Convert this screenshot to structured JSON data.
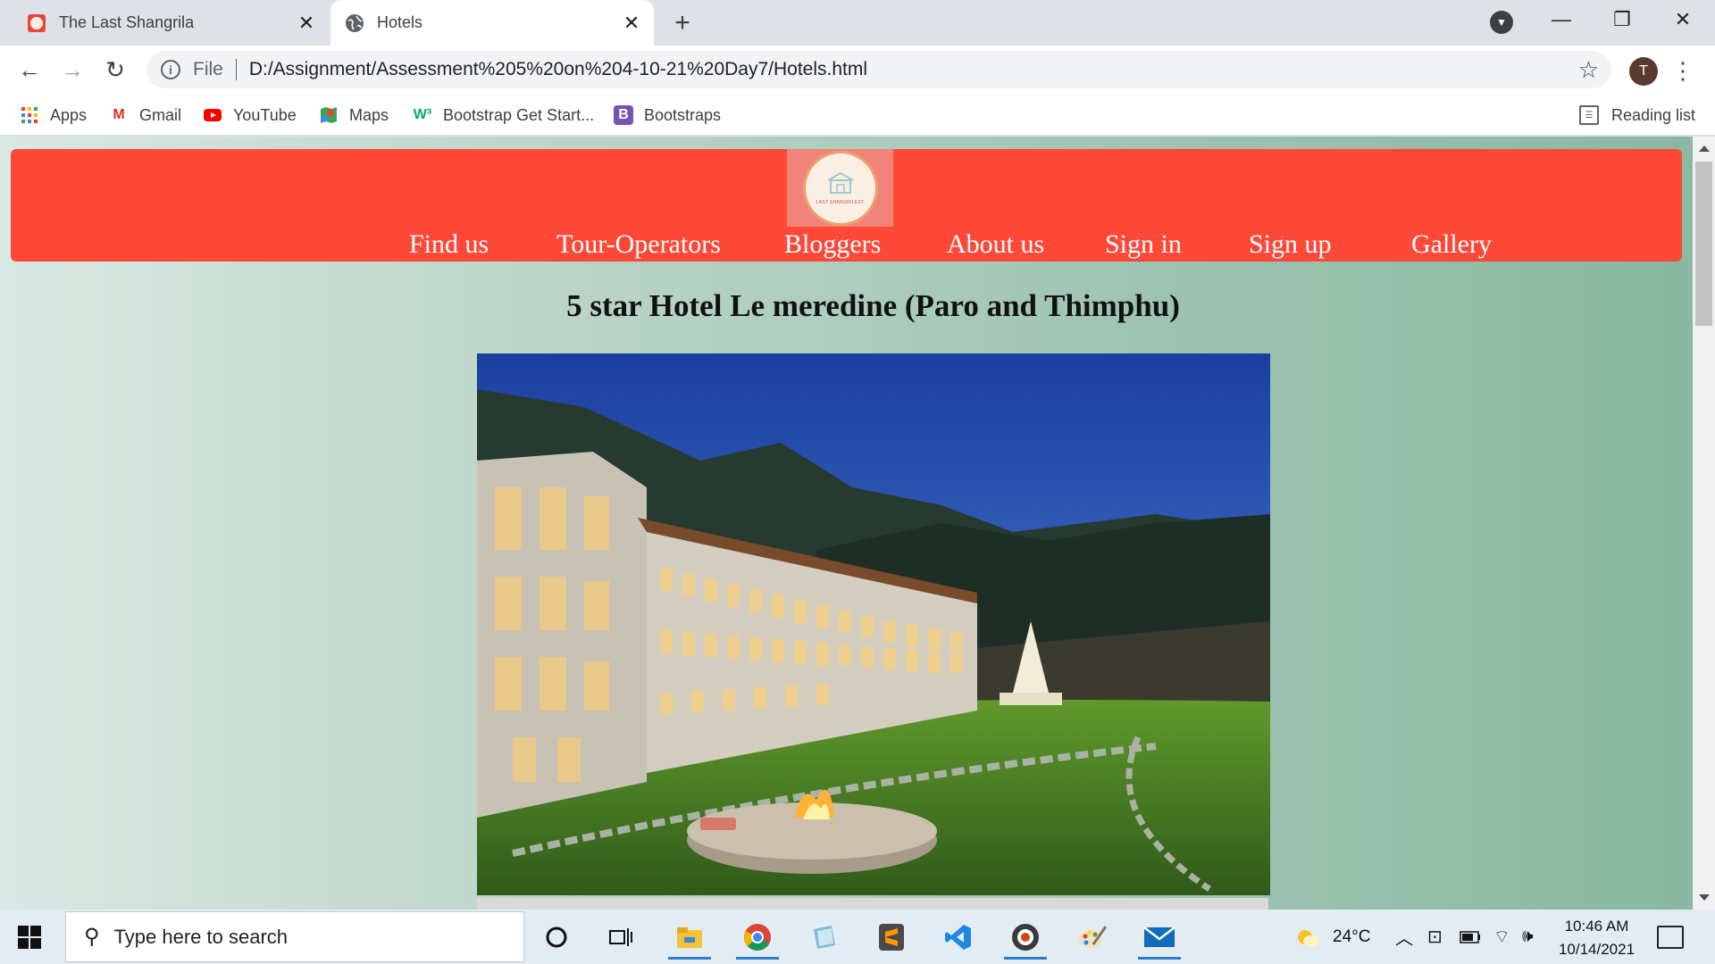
{
  "browser": {
    "tabs": [
      {
        "title": "The Last Shangrila",
        "active": false
      },
      {
        "title": "Hotels",
        "active": true
      }
    ],
    "scheme": "File",
    "url": "D:/Assignment/Assessment%205%20on%204-10-21%20Day7/Hotels.html",
    "avatar_initial": "T",
    "bookmarks": [
      {
        "label": "Apps",
        "icon": "apps-grid-icon"
      },
      {
        "label": "Gmail",
        "icon": "gmail-icon"
      },
      {
        "label": "YouTube",
        "icon": "youtube-icon"
      },
      {
        "label": "Maps",
        "icon": "maps-icon"
      },
      {
        "label": "Bootstrap Get Start...",
        "icon": "w3schools-icon"
      },
      {
        "label": "Bootstraps",
        "icon": "bootstrap-icon"
      }
    ],
    "reading_list": "Reading list"
  },
  "site": {
    "logo_text": "LAST SHANGRILEST",
    "nav": [
      "Find us",
      "Tour-Operators",
      "Bloggers",
      "About us",
      "Sign in",
      "Sign up",
      "Gallery"
    ],
    "hotel_title": "5 star Hotel Le meredine (Paro and Thimphu)",
    "header_color": "#fe4838"
  },
  "taskbar": {
    "search_placeholder": "Type here to search",
    "weather": "24°C",
    "time": "10:46 AM",
    "date": "10/14/2021",
    "apps": [
      "cortana-icon",
      "task-view-icon",
      "file-explorer-icon",
      "chrome-icon",
      "notepad-icon",
      "sublime-text-icon",
      "vscode-icon",
      "media-player-icon",
      "paint-icon",
      "mail-icon"
    ]
  }
}
